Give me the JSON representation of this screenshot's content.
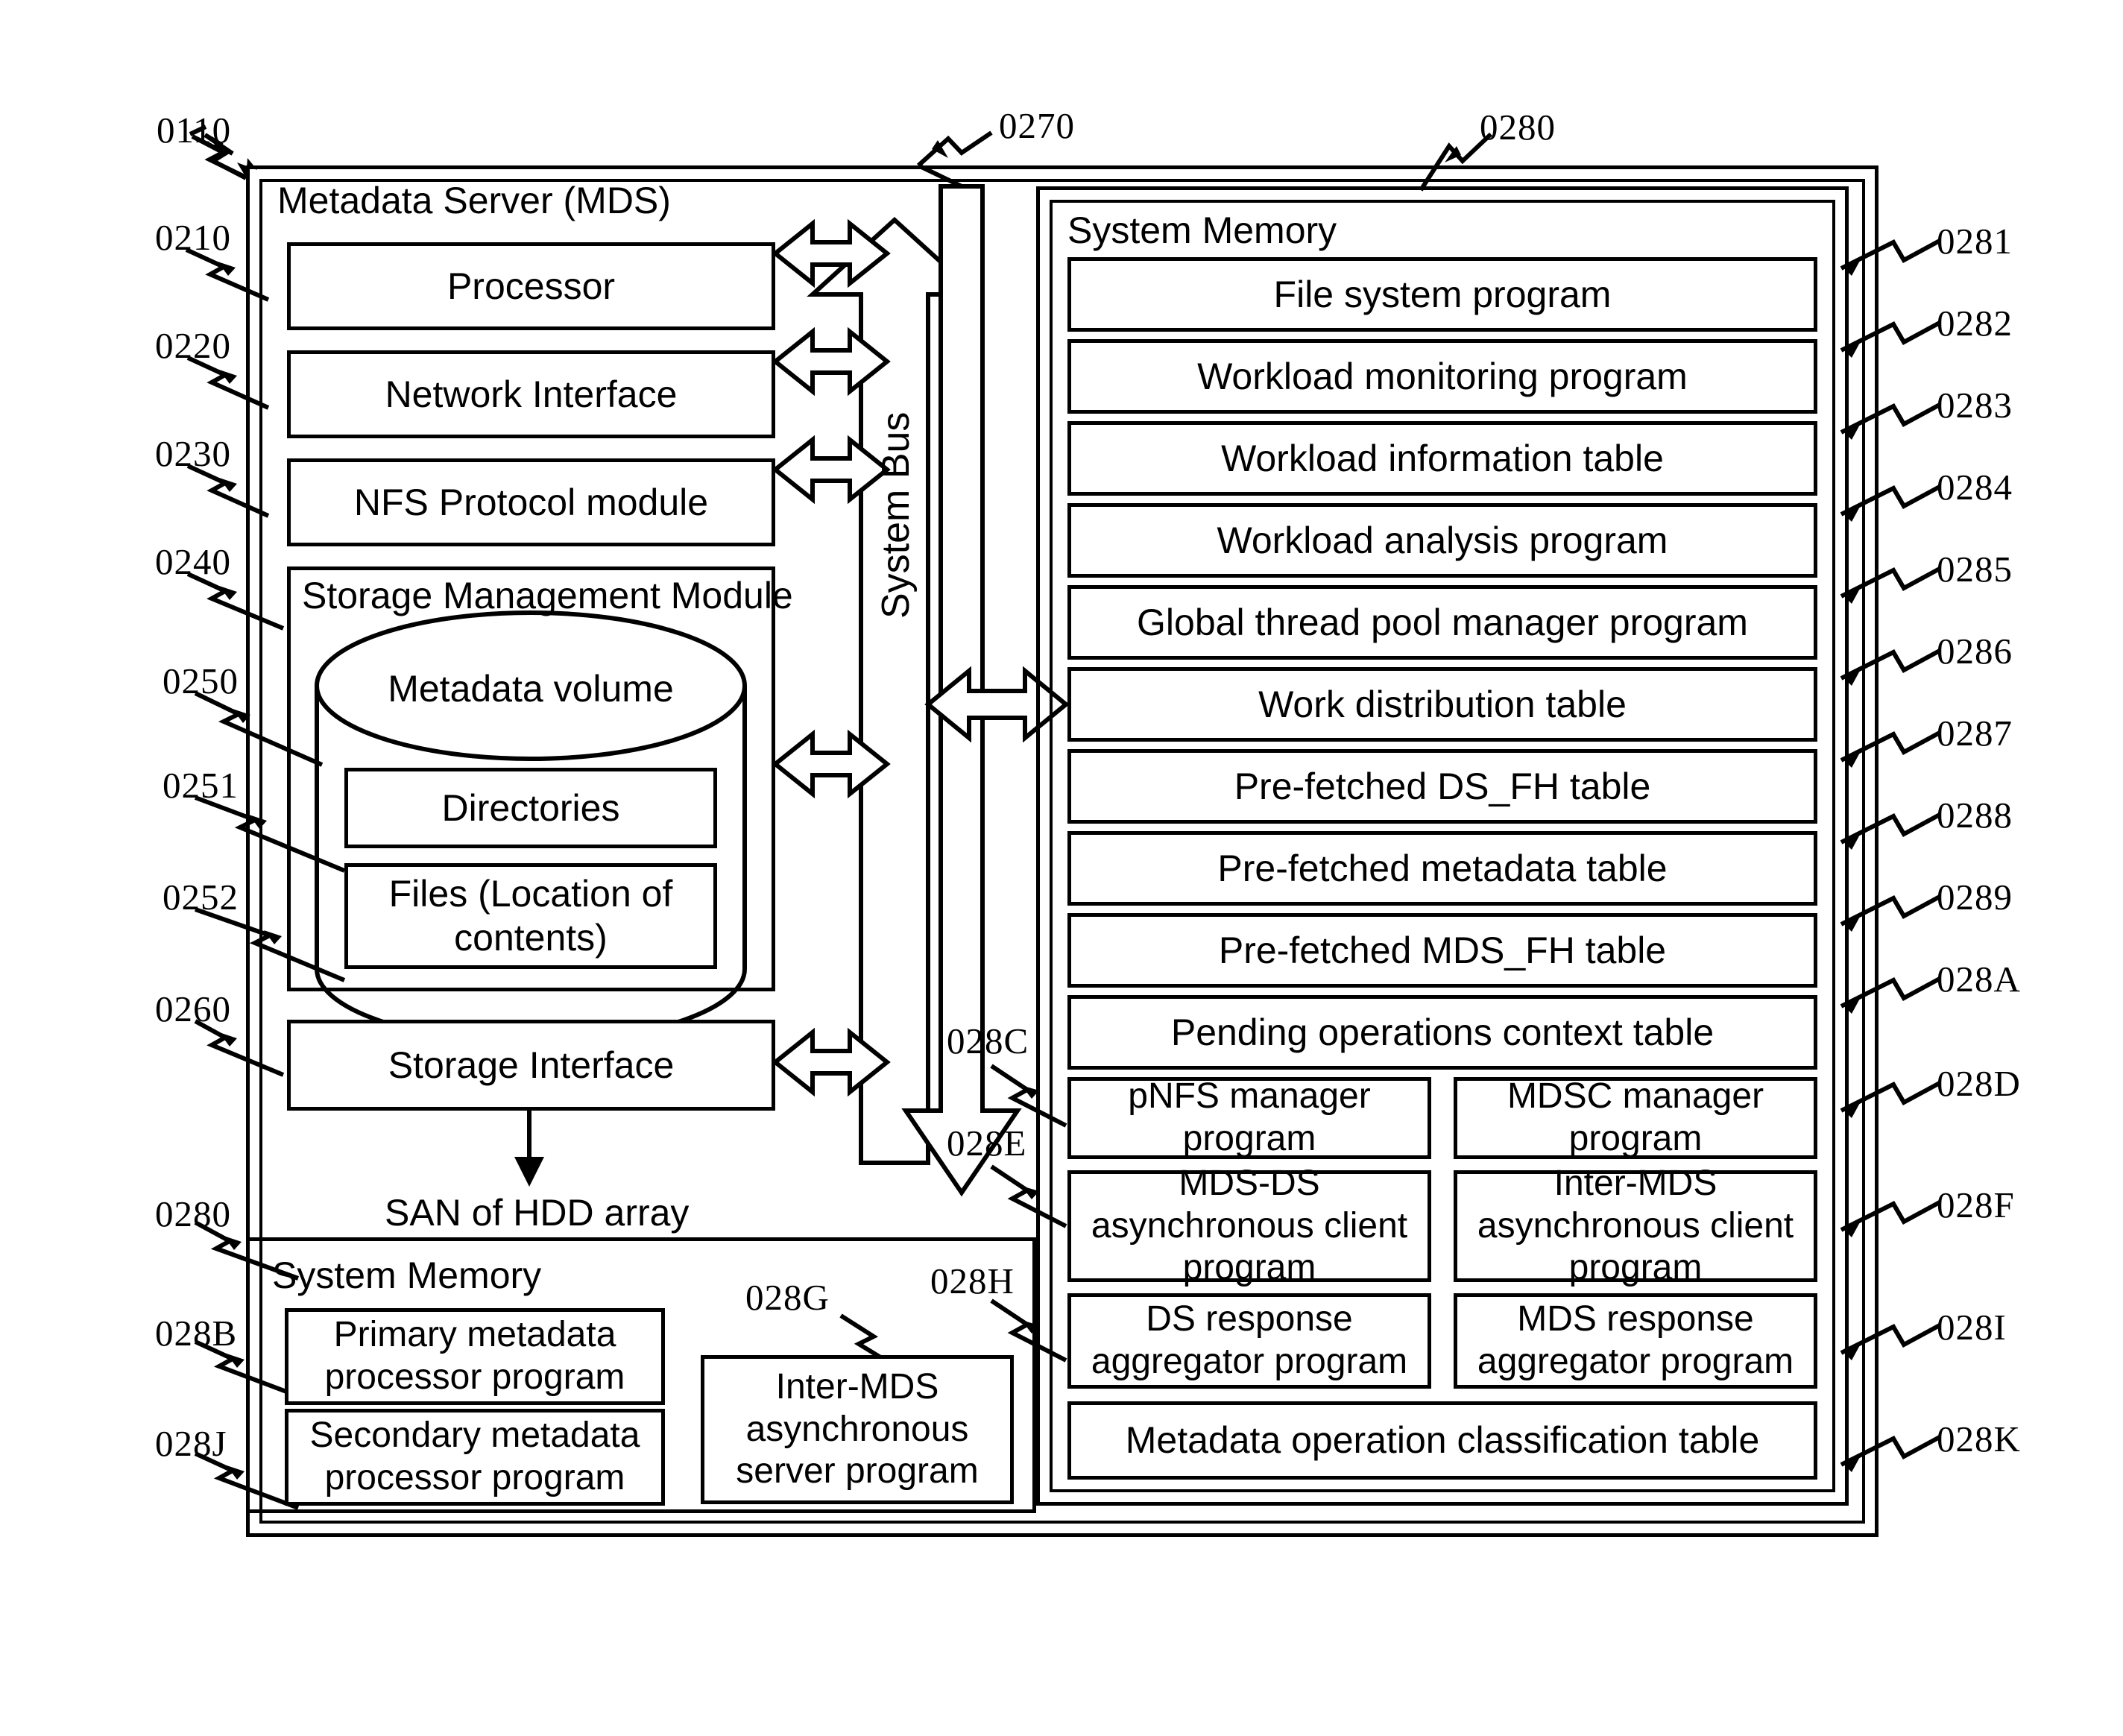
{
  "figure": {
    "title": "Metadata Server (MDS)",
    "outer_ref": "0110",
    "bus_ref": "0270",
    "bus_label": "System Bus",
    "memory_top_ref": "0280",
    "san_label": "SAN of HDD array"
  },
  "left_column": {
    "items": [
      {
        "ref": "0210",
        "label": "Processor"
      },
      {
        "ref": "0220",
        "label": "Network Interface"
      },
      {
        "ref": "0230",
        "label": "NFS Protocol module"
      }
    ],
    "storage_module": {
      "ref": "0240",
      "label": "Storage Management Module",
      "volume": {
        "ref": "0250",
        "label": "Metadata volume",
        "children": [
          {
            "ref": "0251",
            "label": "Directories"
          },
          {
            "ref": "0252",
            "label": "Files (Location of contents)"
          }
        ]
      }
    },
    "storage_interface": {
      "ref": "0260",
      "label": "Storage Interface"
    }
  },
  "system_memory_right": {
    "ref": "0280",
    "title": "System Memory",
    "rows": [
      {
        "ref": "0281",
        "label": "File system program"
      },
      {
        "ref": "0282",
        "label": "Workload monitoring program"
      },
      {
        "ref": "0283",
        "label": "Workload information table"
      },
      {
        "ref": "0284",
        "label": "Workload analysis program"
      },
      {
        "ref": "0285",
        "label": "Global thread pool manager program"
      },
      {
        "ref": "0286",
        "label": "Work distribution table"
      },
      {
        "ref": "0287",
        "label": "Pre-fetched DS_FH table"
      },
      {
        "ref": "0288",
        "label": "Pre-fetched metadata table"
      },
      {
        "ref": "0289",
        "label": "Pre-fetched MDS_FH table"
      },
      {
        "ref": "028A",
        "label": "Pending operations context table"
      }
    ],
    "pairs": [
      {
        "left": {
          "ref": "028C",
          "label": "pNFS manager program"
        },
        "right": {
          "ref": "028D",
          "label": "MDSC manager program"
        }
      },
      {
        "left": {
          "ref": "028E",
          "label": "MDS-DS asynchronous client program"
        },
        "right": {
          "ref": "028F",
          "label": "Inter-MDS asynchronous client program"
        }
      },
      {
        "left": {
          "ref": "028H",
          "label": "DS response aggregator program"
        },
        "right": {
          "ref": "028I",
          "label": "MDS response aggregator program"
        }
      }
    ],
    "footer_row": {
      "ref": "028K",
      "label": "Metadata operation classification table"
    }
  },
  "system_memory_bottom": {
    "ref": "0280",
    "title": "System Memory",
    "rows": [
      {
        "ref": "028B",
        "label": "Primary metadata processor program"
      },
      {
        "ref": "028J",
        "label": "Secondary metadata processor program"
      }
    ],
    "side_box": {
      "ref": "028G",
      "label": "Inter-MDS asynchronous server program"
    }
  },
  "colors": {
    "line": "#000000",
    "background": "#ffffff"
  }
}
